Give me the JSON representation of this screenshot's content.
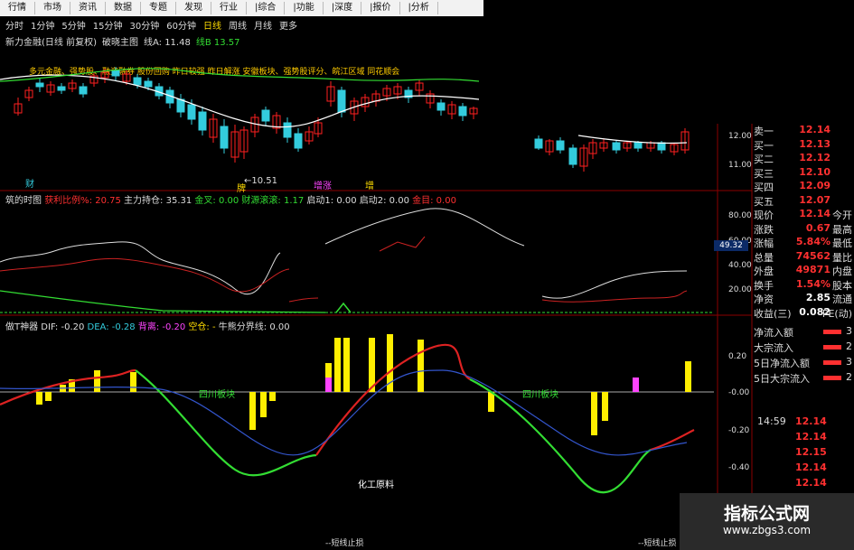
{
  "top_menu": [
    "行情",
    "市场",
    "资讯",
    "数据",
    "专题",
    "发现",
    "行业",
    "|综合",
    "|功能",
    "|深度",
    "|报价",
    "|分析"
  ],
  "periods": [
    "分时",
    "1分钟",
    "5分钟",
    "15分钟",
    "30分钟",
    "60分钟",
    "日线",
    "周线",
    "月线",
    "更多"
  ],
  "main_title": {
    "name": "新力金融(日线 前复权)",
    "indicator": "破晓主图",
    "price": "线A: 11.48",
    "line_b": "线B 13.57"
  },
  "tags_text": "多元金融、强势股、融资融券  股份回购  昨日较强  昨日解涨  安徽板块、强势股评分、皖江区域  同花顺会",
  "main_markers": {
    "left": "财",
    "mid_low": "←10.51",
    "mid2": "增",
    "mid3": "增",
    "tag_mid": "牌",
    "tag_mid2": "增涨"
  },
  "main_axis": [
    "12.00",
    "11.00"
  ],
  "panel2": {
    "title": "筑的时图",
    "items": [
      {
        "text": "获利比例%: 20.75",
        "color": "red"
      },
      {
        "text": "主力持仓: 35.31",
        "color": "white"
      },
      {
        "text": "金叉: 0.00",
        "color": "green"
      },
      {
        "text": "财源滚滚: 1.17",
        "color": "green"
      },
      {
        "text": "启动1: 0.00",
        "color": "white"
      },
      {
        "text": "启动2: 0.00",
        "color": "white"
      },
      {
        "text": "金目: 0.00",
        "color": "red"
      }
    ],
    "axis": [
      "80.00",
      "60.00",
      "40.00",
      "20.00"
    ],
    "tag": "49.32"
  },
  "panel3": {
    "title": "做T神器",
    "items": [
      {
        "text": "DIF: -0.20",
        "color": "white"
      },
      {
        "text": "DEA: -0.28",
        "color": "cyan"
      },
      {
        "text": "背离: -0.20",
        "color": "magenta"
      },
      {
        "text": "空仓: -",
        "color": "yellow"
      },
      {
        "text": "牛熊分界线: 0.00",
        "color": "white"
      }
    ],
    "axis": [
      "0.20",
      "-0.00",
      "-0.20",
      "-0.40"
    ],
    "labels": {
      "zone1": "四川板块",
      "zone2": "四川板块",
      "chem": "化工原料",
      "stop1": "--短线止损",
      "stop2": "--短线止损"
    }
  },
  "quote": [
    {
      "label": "卖一",
      "value": "12.14",
      "sub": ""
    },
    {
      "label": "买一",
      "value": "12.13",
      "sub": ""
    },
    {
      "label": "买二",
      "value": "12.12",
      "sub": ""
    },
    {
      "label": "买三",
      "value": "12.10",
      "sub": ""
    },
    {
      "label": "买四",
      "value": "12.09",
      "sub": ""
    },
    {
      "label": "买五",
      "value": "12.07",
      "sub": ""
    },
    {
      "label": "现价",
      "value": "12.14",
      "sub": "今开"
    },
    {
      "label": "涨跌",
      "value": "0.67",
      "sub": "最高"
    },
    {
      "label": "涨幅",
      "value": "5.84%",
      "sub": "最低"
    },
    {
      "label": "总量",
      "value": "74562",
      "sub": "量比"
    },
    {
      "label": "外盘",
      "value": "49871",
      "sub": "内盘"
    },
    {
      "label": "换手",
      "value": "1.54%",
      "sub": "股本"
    },
    {
      "label": "净资",
      "value": "2.85",
      "sub": "流通"
    },
    {
      "label": "收益(三)",
      "value": "0.082",
      "sub": "PE(动)"
    }
  ],
  "flows": [
    {
      "label": "净流入额",
      "value": "3"
    },
    {
      "label": "大宗流入",
      "value": "2"
    },
    {
      "label": "5日净流入额",
      "value": "3"
    },
    {
      "label": "5日大宗流入",
      "value": "2"
    }
  ],
  "ticks": {
    "time": "14:59",
    "prices": [
      "12.14",
      "12.14",
      "12.15",
      "12.14",
      "12.14"
    ]
  },
  "watermark": {
    "line1": "指标公式网",
    "line2": "www.zbgs3.com"
  },
  "colors": {
    "up": "#ff2020",
    "down": "#33ccdd",
    "ma": "#ffffff",
    "green": "#33dd33",
    "yellow": "#ffee00",
    "accent": "#ff3030"
  }
}
